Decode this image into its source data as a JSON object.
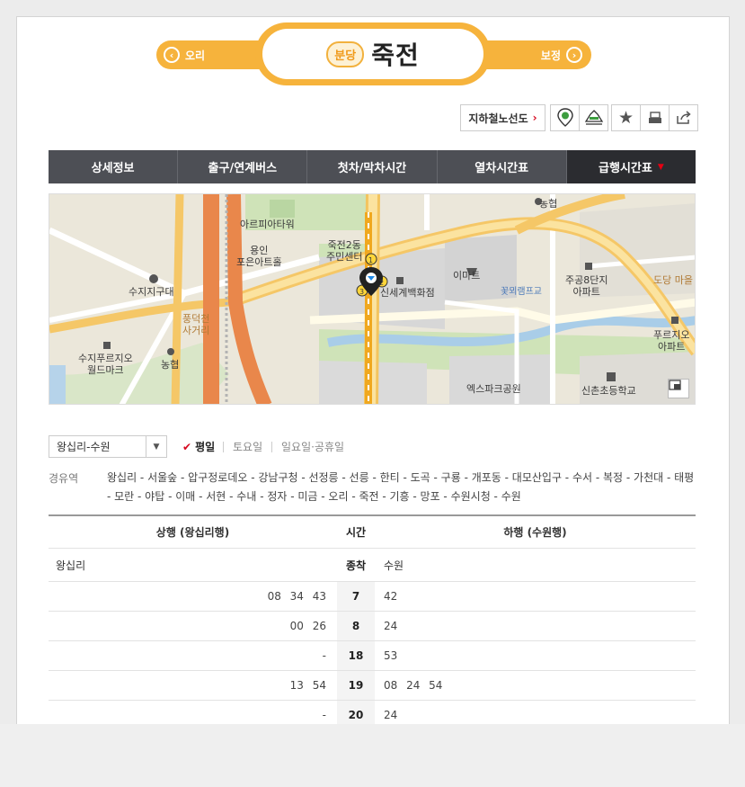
{
  "header": {
    "prev_station": "오리",
    "next_station": "보정",
    "line_badge": "분당",
    "station": "죽전"
  },
  "tools": {
    "subway_map": "지하철노선도"
  },
  "tabs": [
    {
      "label": "상세정보"
    },
    {
      "label": "출구/연계버스"
    },
    {
      "label": "첫차/막차시간"
    },
    {
      "label": "열차시간표"
    },
    {
      "label": "급행시간표",
      "active": true
    }
  ],
  "map": {
    "labels": {
      "artpia": "아르피아타워",
      "poeun": "용인\n포은아트홀",
      "center": "죽전2동\n주민센터",
      "police": "수지지구대",
      "pungdeok": "풍덕천\n사거리",
      "prugio_world": "수지푸르지오\n월드마크",
      "nonghyup1": "농협",
      "shinsegae": "신세계백화점",
      "emart": "이마트",
      "jugong": "주공8단지\n아파트",
      "dodang": "도당 마을",
      "prugio": "푸르지오\n아파트",
      "nonghyup2": "농협",
      "expark": "엑스파크공원",
      "school": "신촌초등학교",
      "kkotmoe": "꽃뫼램프교",
      "exit1": "1",
      "exit2": "2",
      "exit3": "3"
    }
  },
  "direction": {
    "selected": "왕십리-수원",
    "day_types": [
      "평일",
      "토요일",
      "일요일·공휴일"
    ],
    "active_day": "평일"
  },
  "via": {
    "title": "경유역",
    "stations": "왕십리 - 서울숲 - 압구정로데오 - 강남구청 - 선정릉 - 선릉 - 한티 - 도곡 - 구룡 - 개포동 - 대모산입구 - 수서 - 복정 - 가천대 - 태평 - 모란 - 야탑 - 이매 - 서현 - 수내 - 정자 - 미금 - 오리 - 죽전 - 기흥 - 망포 - 수원시청 - 수원"
  },
  "table": {
    "header_up": "상행 (왕십리행)",
    "header_time": "시간",
    "header_down": "하행 (수원행)",
    "terminal_up": "왕십리",
    "terminal_label": "종착",
    "terminal_down": "수원",
    "rows": [
      {
        "hour": "7",
        "up": "08 34 43",
        "down": "42"
      },
      {
        "hour": "8",
        "up": "00 26",
        "down": "24"
      },
      {
        "hour": "18",
        "up": "-",
        "down": "53"
      },
      {
        "hour": "19",
        "up": "13 54",
        "down": "08 24 54"
      },
      {
        "hour": "20",
        "up": "-",
        "down": "24"
      }
    ]
  },
  "colors": {
    "accent": "#f6b33c",
    "tab_bg": "#4d4f55",
    "tab_active": "#2b2c30",
    "red": "#d6081f"
  }
}
